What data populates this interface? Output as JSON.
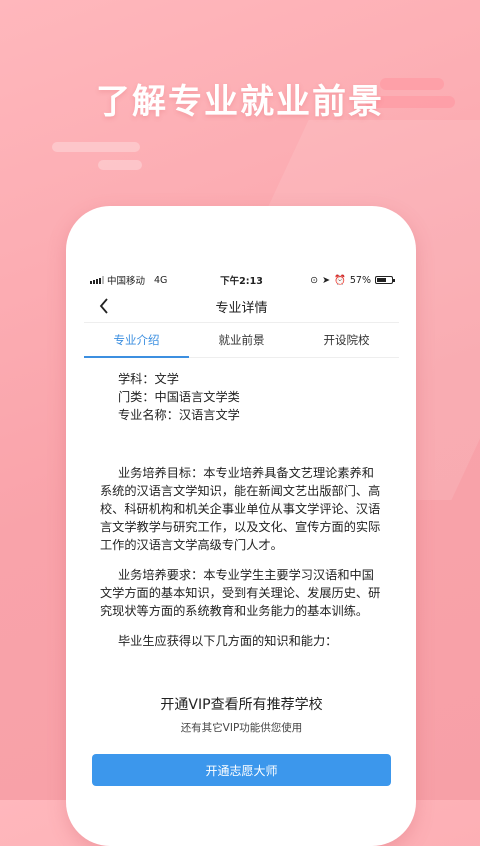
{
  "headline": "了解专业就业前景",
  "status_bar": {
    "carrier": "中国移动",
    "network": "4G",
    "time": "下午2:13",
    "battery_percent": "57%"
  },
  "nav": {
    "title": "专业详情"
  },
  "tabs": [
    {
      "label": "专业介绍",
      "active": true
    },
    {
      "label": "就业前景",
      "active": false
    },
    {
      "label": "开设院校",
      "active": false
    }
  ],
  "info": {
    "subject": "学科：文学",
    "category": "门类：中国语言文学类",
    "major_name": "专业名称：汉语言文学"
  },
  "paragraphs": [
    "业务培养目标：本专业培养具备文艺理论素养和系统的汉语言文学知识，能在新闻文艺出版部门、高校、科研机构和机关企事业单位从事文学评论、汉语言文学教学与研究工作，以及文化、宣传方面的实际工作的汉语言文学高级专门人才。",
    "业务培养要求：本专业学生主要学习汉语和中国文学方面的基本知识，受到有关理论、发展历史、研究现状等方面的系统教育和业务能力的基本训练。",
    "毕业生应获得以下几方面的知识和能力："
  ],
  "vip_sheet": {
    "title": "开通VIP查看所有推荐学校",
    "subtitle": "还有其它VIP功能供您使用",
    "button_label": "开通志愿大师"
  },
  "colors": {
    "accent": "#3c8fe0",
    "button": "#3c97ec",
    "background": "#f9a3aa"
  }
}
